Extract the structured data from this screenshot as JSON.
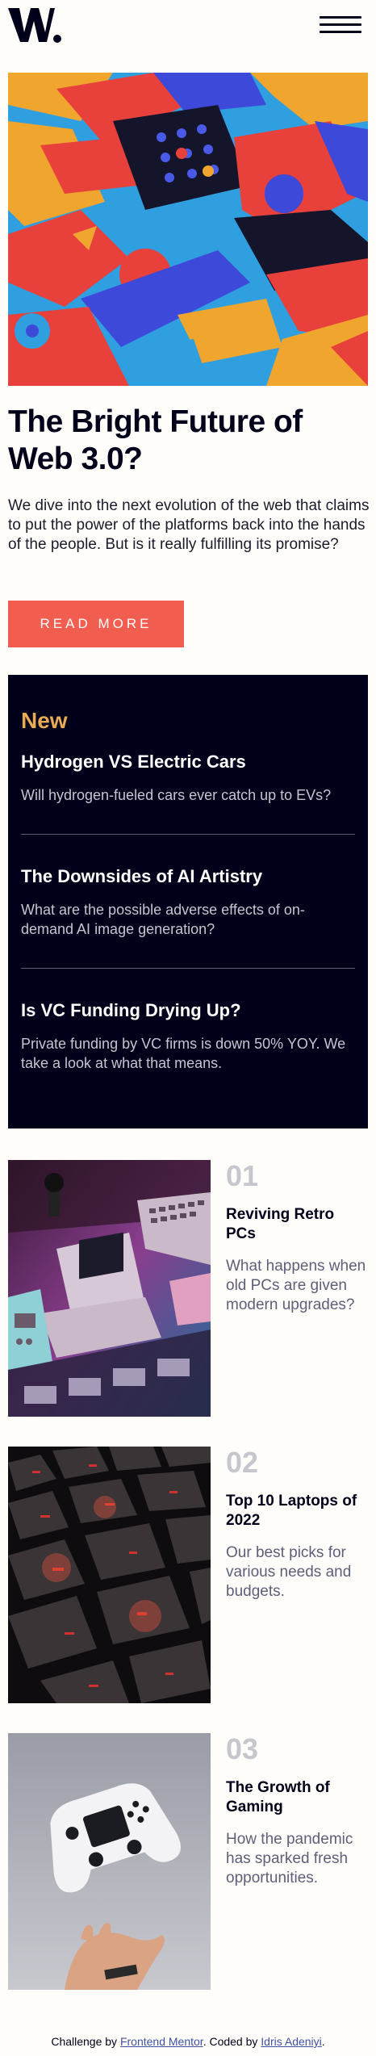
{
  "header": {
    "logo_text": "W.",
    "menu_icon": "hamburger-menu-icon"
  },
  "hero": {
    "image_icon": "abstract-3d-blocks-image",
    "title": "The Bright Future of Web 3.0?",
    "description": "We dive into the next evolution of the web that claims to put the power of the platforms back into the hands of the people. But is it really fulfilling its promise?",
    "button_label": "READ MORE"
  },
  "new_panel": {
    "heading": "New",
    "items": [
      {
        "title": "Hydrogen VS Electric Cars",
        "description": "Will hydrogen-fueled cars ever catch up to EVs?"
      },
      {
        "title": "The Downsides of AI Artistry",
        "description": "What are the possible adverse effects of on-demand AI image generation?"
      },
      {
        "title": "Is VC Funding Drying Up?",
        "description": "Private funding by VC firms is down 50% YOY. We take a look at what that means."
      }
    ]
  },
  "list": [
    {
      "number": "01",
      "title": "Reviving Retro PCs",
      "description": "What happens when old PCs are given modern upgrades?",
      "image": "retro-pc-image"
    },
    {
      "number": "02",
      "title": "Top 10 Laptops of 2022",
      "description": "Our best picks for various needs and budgets.",
      "image": "laptop-keyboard-image"
    },
    {
      "number": "03",
      "title": "The Growth of Gaming",
      "description": "How the pandemic has sparked fresh opportunities.",
      "image": "gaming-controller-image"
    }
  ],
  "footer": {
    "prefix": "Challenge by ",
    "link1": "Frontend Mentor",
    "middle": ". Coded by ",
    "link2": "Idris Adeniyi",
    "suffix": "."
  },
  "colors": {
    "accent": "#f15e50",
    "new_heading": "#e9ab53",
    "dark": "#00001a",
    "background": "#fffdfa"
  }
}
